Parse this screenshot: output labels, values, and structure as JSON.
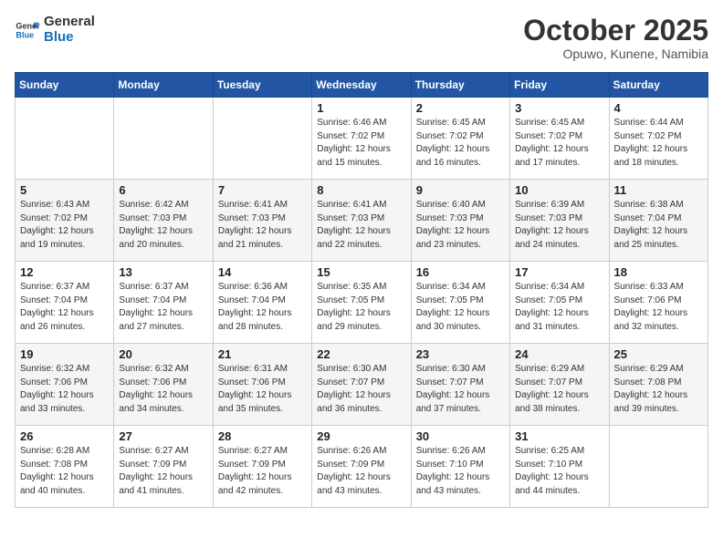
{
  "header": {
    "logo_line1": "General",
    "logo_line2": "Blue",
    "month": "October 2025",
    "location": "Opuwo, Kunene, Namibia"
  },
  "weekdays": [
    "Sunday",
    "Monday",
    "Tuesday",
    "Wednesday",
    "Thursday",
    "Friday",
    "Saturday"
  ],
  "weeks": [
    [
      {
        "day": "",
        "info": ""
      },
      {
        "day": "",
        "info": ""
      },
      {
        "day": "",
        "info": ""
      },
      {
        "day": "1",
        "info": "Sunrise: 6:46 AM\nSunset: 7:02 PM\nDaylight: 12 hours and 15 minutes."
      },
      {
        "day": "2",
        "info": "Sunrise: 6:45 AM\nSunset: 7:02 PM\nDaylight: 12 hours and 16 minutes."
      },
      {
        "day": "3",
        "info": "Sunrise: 6:45 AM\nSunset: 7:02 PM\nDaylight: 12 hours and 17 minutes."
      },
      {
        "day": "4",
        "info": "Sunrise: 6:44 AM\nSunset: 7:02 PM\nDaylight: 12 hours and 18 minutes."
      }
    ],
    [
      {
        "day": "5",
        "info": "Sunrise: 6:43 AM\nSunset: 7:02 PM\nDaylight: 12 hours and 19 minutes."
      },
      {
        "day": "6",
        "info": "Sunrise: 6:42 AM\nSunset: 7:03 PM\nDaylight: 12 hours and 20 minutes."
      },
      {
        "day": "7",
        "info": "Sunrise: 6:41 AM\nSunset: 7:03 PM\nDaylight: 12 hours and 21 minutes."
      },
      {
        "day": "8",
        "info": "Sunrise: 6:41 AM\nSunset: 7:03 PM\nDaylight: 12 hours and 22 minutes."
      },
      {
        "day": "9",
        "info": "Sunrise: 6:40 AM\nSunset: 7:03 PM\nDaylight: 12 hours and 23 minutes."
      },
      {
        "day": "10",
        "info": "Sunrise: 6:39 AM\nSunset: 7:03 PM\nDaylight: 12 hours and 24 minutes."
      },
      {
        "day": "11",
        "info": "Sunrise: 6:38 AM\nSunset: 7:04 PM\nDaylight: 12 hours and 25 minutes."
      }
    ],
    [
      {
        "day": "12",
        "info": "Sunrise: 6:37 AM\nSunset: 7:04 PM\nDaylight: 12 hours and 26 minutes."
      },
      {
        "day": "13",
        "info": "Sunrise: 6:37 AM\nSunset: 7:04 PM\nDaylight: 12 hours and 27 minutes."
      },
      {
        "day": "14",
        "info": "Sunrise: 6:36 AM\nSunset: 7:04 PM\nDaylight: 12 hours and 28 minutes."
      },
      {
        "day": "15",
        "info": "Sunrise: 6:35 AM\nSunset: 7:05 PM\nDaylight: 12 hours and 29 minutes."
      },
      {
        "day": "16",
        "info": "Sunrise: 6:34 AM\nSunset: 7:05 PM\nDaylight: 12 hours and 30 minutes."
      },
      {
        "day": "17",
        "info": "Sunrise: 6:34 AM\nSunset: 7:05 PM\nDaylight: 12 hours and 31 minutes."
      },
      {
        "day": "18",
        "info": "Sunrise: 6:33 AM\nSunset: 7:06 PM\nDaylight: 12 hours and 32 minutes."
      }
    ],
    [
      {
        "day": "19",
        "info": "Sunrise: 6:32 AM\nSunset: 7:06 PM\nDaylight: 12 hours and 33 minutes."
      },
      {
        "day": "20",
        "info": "Sunrise: 6:32 AM\nSunset: 7:06 PM\nDaylight: 12 hours and 34 minutes."
      },
      {
        "day": "21",
        "info": "Sunrise: 6:31 AM\nSunset: 7:06 PM\nDaylight: 12 hours and 35 minutes."
      },
      {
        "day": "22",
        "info": "Sunrise: 6:30 AM\nSunset: 7:07 PM\nDaylight: 12 hours and 36 minutes."
      },
      {
        "day": "23",
        "info": "Sunrise: 6:30 AM\nSunset: 7:07 PM\nDaylight: 12 hours and 37 minutes."
      },
      {
        "day": "24",
        "info": "Sunrise: 6:29 AM\nSunset: 7:07 PM\nDaylight: 12 hours and 38 minutes."
      },
      {
        "day": "25",
        "info": "Sunrise: 6:29 AM\nSunset: 7:08 PM\nDaylight: 12 hours and 39 minutes."
      }
    ],
    [
      {
        "day": "26",
        "info": "Sunrise: 6:28 AM\nSunset: 7:08 PM\nDaylight: 12 hours and 40 minutes."
      },
      {
        "day": "27",
        "info": "Sunrise: 6:27 AM\nSunset: 7:09 PM\nDaylight: 12 hours and 41 minutes."
      },
      {
        "day": "28",
        "info": "Sunrise: 6:27 AM\nSunset: 7:09 PM\nDaylight: 12 hours and 42 minutes."
      },
      {
        "day": "29",
        "info": "Sunrise: 6:26 AM\nSunset: 7:09 PM\nDaylight: 12 hours and 43 minutes."
      },
      {
        "day": "30",
        "info": "Sunrise: 6:26 AM\nSunset: 7:10 PM\nDaylight: 12 hours and 43 minutes."
      },
      {
        "day": "31",
        "info": "Sunrise: 6:25 AM\nSunset: 7:10 PM\nDaylight: 12 hours and 44 minutes."
      },
      {
        "day": "",
        "info": ""
      }
    ]
  ]
}
